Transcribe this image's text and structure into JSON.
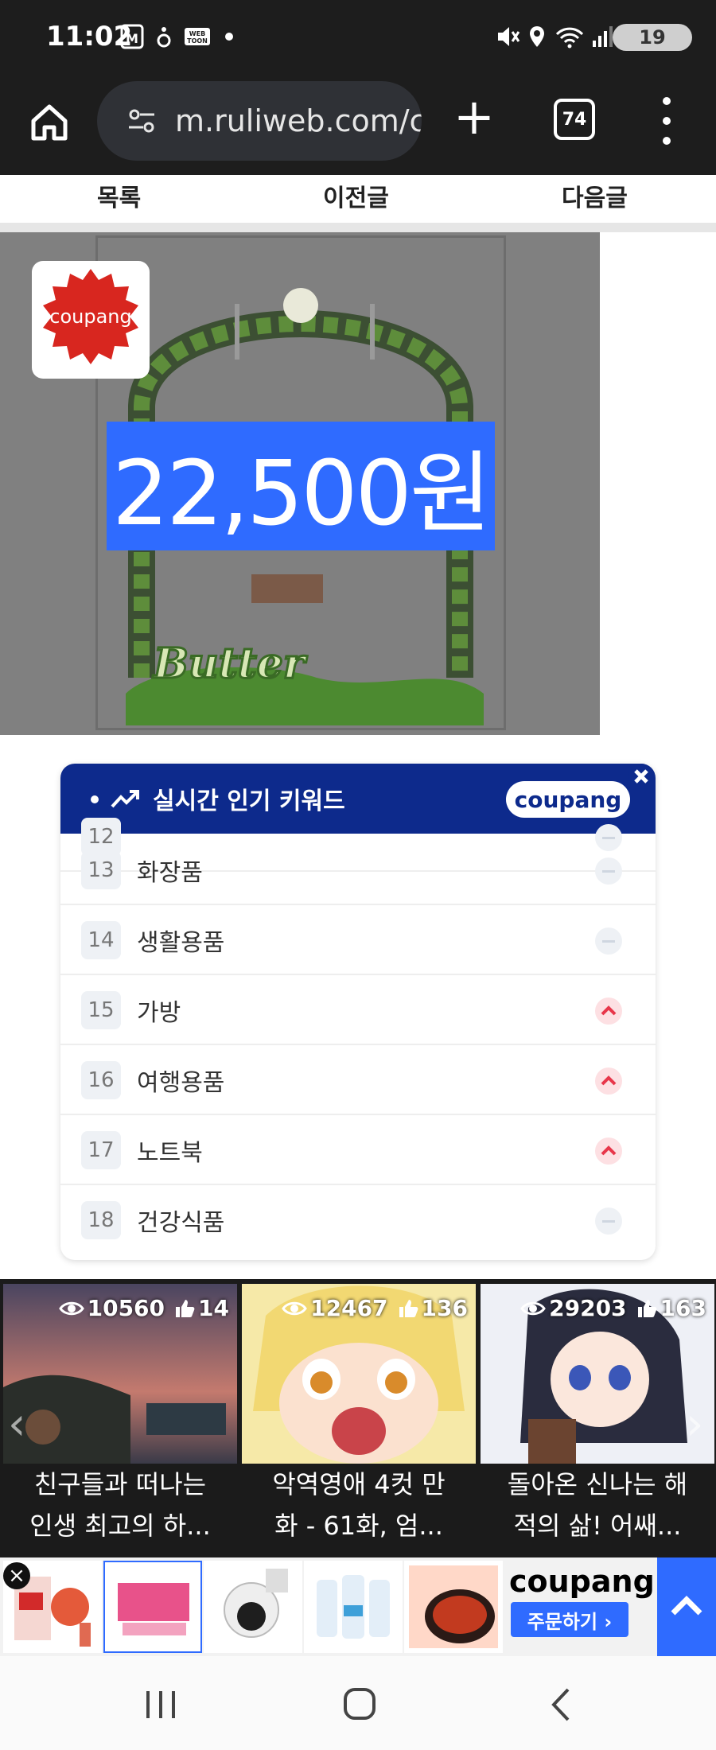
{
  "status_bar": {
    "time": "11:02",
    "battery": "19",
    "icons": [
      "lock-app-icon",
      "notification-icon",
      "webtoon-icon",
      "dot-icon",
      "mute-icon",
      "location-icon",
      "wifi-icon",
      "signal-icon"
    ]
  },
  "browser": {
    "url": "m.ruliweb.com/cc",
    "tab_count": "74"
  },
  "post_nav": {
    "list_label": "목록",
    "prev_label": "이전글",
    "next_label": "다음글"
  },
  "ad_banner": {
    "logo_text": "coupang",
    "price": "22,500원",
    "product_logo_text": "Butter",
    "colors": {
      "price_bg": "#2f6bff",
      "logo_red": "#d8261f"
    }
  },
  "keyword_widget": {
    "title": "실시간 인기 키워드",
    "brand": "coupang",
    "keywords": [
      {
        "rank": "12",
        "word": "",
        "trend": "same"
      },
      {
        "rank": "13",
        "word": "화장품",
        "trend": "same"
      },
      {
        "rank": "14",
        "word": "생활용품",
        "trend": "same"
      },
      {
        "rank": "15",
        "word": "가방",
        "trend": "up"
      },
      {
        "rank": "16",
        "word": "여행용품",
        "trend": "up"
      },
      {
        "rank": "17",
        "word": "노트북",
        "trend": "up"
      },
      {
        "rank": "18",
        "word": "건강식품",
        "trend": "same"
      }
    ],
    "colors": {
      "header": "#0d2a8c",
      "up_arrow": "#e8364a"
    }
  },
  "thumbnails": [
    {
      "views": "10560",
      "likes": "14",
      "caption_line1": "친구들과 떠나는",
      "caption_line2": "인생 최고의 하..."
    },
    {
      "views": "12467",
      "likes": "136",
      "caption_line1": "악역영애 4컷 만",
      "caption_line2": "화 - 61화, 엄..."
    },
    {
      "views": "29203",
      "likes": "163",
      "caption_line1": "돌아온 신나는 해",
      "caption_line2": "적의 삶! 어쌔..."
    }
  ],
  "product_bar": {
    "brand": "coupang",
    "order_label": "주문하기 ›"
  }
}
